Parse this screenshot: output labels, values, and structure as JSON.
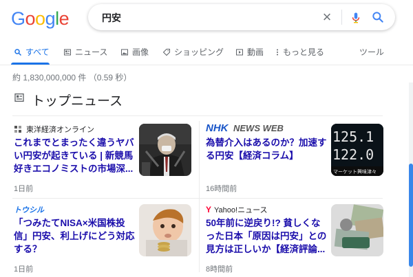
{
  "header": {
    "logo_letters": [
      "G",
      "o",
      "o",
      "g",
      "l",
      "e"
    ],
    "logo_colors": [
      "#4285F4",
      "#EA4335",
      "#FBBC05",
      "#4285F4",
      "#34A853",
      "#EA4335"
    ],
    "query": "円安"
  },
  "tabs": [
    {
      "label": "すべて",
      "icon": "search-icon",
      "active": true
    },
    {
      "label": "ニュース",
      "icon": "news-icon",
      "active": false
    },
    {
      "label": "画像",
      "icon": "image-icon",
      "active": false
    },
    {
      "label": "ショッピング",
      "icon": "tag-icon",
      "active": false
    },
    {
      "label": "動画",
      "icon": "video-icon",
      "active": false
    },
    {
      "label": "もっと見る",
      "icon": "more-dots-icon",
      "active": false
    },
    {
      "label": "ツール",
      "icon": "",
      "active": false
    }
  ],
  "result_stats": "約 1,830,000,000 件 （0.59 秒）",
  "section_title": "トップニュース",
  "news": [
    {
      "source": "東洋経済オンライン",
      "headline": "これまでとまったく違うヤバい円安が起きている | 新競馬好きエコノミストの市場深...",
      "age": "1日前"
    },
    {
      "source": "NHK NEWS WEB",
      "headline": "為替介入はあるのか？加速する円安【経済コラム】",
      "age": "16時間前",
      "thumb_caption": "マーケット興味津々",
      "thumb_numbers": [
        "125.1",
        "122.0"
      ]
    },
    {
      "source": "トウシル",
      "headline": "「つみたてNISA×米国株投信」円安、利上げにどう対応する？",
      "age": "1日前"
    },
    {
      "source": "Yahoo!ニュース",
      "headline": "50年前に逆戻り!? 貧しくなった日本「原因は円安」との見方は正しいか【経済評論...",
      "age": "8時間前"
    }
  ]
}
